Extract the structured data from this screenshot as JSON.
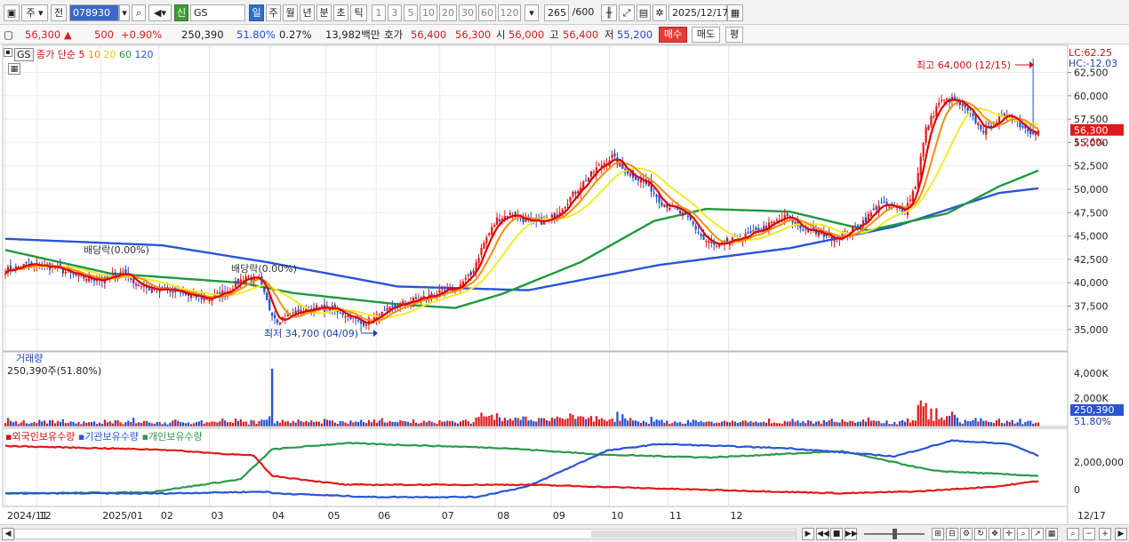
{
  "toolbar": {
    "market": "주",
    "prev": "전",
    "code": "078930",
    "badge_sin": "신",
    "name": "GS",
    "periods": [
      "일",
      "주",
      "월",
      "년",
      "분",
      "초",
      "틱"
    ],
    "active_period": "일",
    "intervals": [
      "1",
      "3",
      "5",
      "10",
      "20",
      "30",
      "60",
      "120"
    ],
    "count": "265",
    "count_total": "/600",
    "date": "2025/12/17"
  },
  "quote": {
    "price": "56,300",
    "arrow": "▲",
    "change": "500",
    "change_pct": "+0.90%",
    "volume": "250,390",
    "vol_ratio": "51.80%",
    "turnover_pct": "0.27%",
    "amount": "13,982백만",
    "ask_label": "호가",
    "ask1": "56,400",
    "bid1": "56,300",
    "open_label": "시",
    "open": "56,000",
    "high_label": "고",
    "high": "56,400",
    "low_label": "저",
    "low": "55,200",
    "buy": "매수",
    "sell": "매도",
    "avg": "평"
  },
  "colors": {
    "up": "#e01a1a",
    "down": "#1f4fd0",
    "ma5": "#e00000",
    "ma10": "#f0900a",
    "ma20": "#f3ea2a",
    "ma60": "#1f9a3c",
    "ma120": "#2a54d6",
    "foreign": "#e01a1a",
    "inst": "#2a54d6",
    "indiv": "#2a9a4a"
  },
  "price_panel": {
    "symbol_tag": "GS",
    "legend_title": "종가 단순",
    "ma_periods": [
      "5",
      "10",
      "20",
      "60",
      "120"
    ],
    "lc": "LC:62.25",
    "hc": "HC:-12.03",
    "max_label": "최고 64,000 (12/15)",
    "min_label": "최저 34,700 (04/09)",
    "div1": "배당락(0.00%)",
    "div2": "배당락(0.00%)",
    "last_price_tag": "56,300",
    "last_pct_tag": "1.26%"
  },
  "volume_panel": {
    "title": "거래량",
    "value": "250,390주(51.80%)",
    "axis_labels": [
      "4,000K",
      "2,000K"
    ],
    "last_tag": "250,390",
    "last_pct": "51.80%"
  },
  "holder_panel": {
    "legend": [
      "외국인보유수량",
      "기관보유수량",
      "개인보유수량"
    ],
    "axis_labels": [
      "2,000,000",
      "0"
    ]
  },
  "x_axis": {
    "labels": [
      "2024/11",
      "12",
      "2025/01",
      "02",
      "03",
      "04",
      "05",
      "06",
      "07",
      "08",
      "09",
      "10",
      "11",
      "12"
    ],
    "right_label": "12/17"
  },
  "chart_data": {
    "type": "candlestick",
    "y_ticks": [
      35000,
      37500,
      40000,
      42500,
      45000,
      47500,
      50000,
      52500,
      55000,
      57500,
      60000,
      62500
    ],
    "ylim": [
      32700,
      65300
    ],
    "max": {
      "value": 64000,
      "date": "12/15"
    },
    "min": {
      "value": 34700,
      "date": "04/09"
    },
    "close_anchors": [
      [
        0,
        41300
      ],
      [
        8,
        41900
      ],
      [
        18,
        41700
      ],
      [
        28,
        40600
      ],
      [
        38,
        40300
      ],
      [
        45,
        41200
      ],
      [
        52,
        39500
      ],
      [
        62,
        39300
      ],
      [
        70,
        38600
      ],
      [
        78,
        38300
      ],
      [
        85,
        39200
      ],
      [
        92,
        40700
      ],
      [
        97,
        40200
      ],
      [
        101,
        37200
      ],
      [
        104,
        36000
      ],
      [
        111,
        36800
      ],
      [
        118,
        37300
      ],
      [
        125,
        37200
      ],
      [
        132,
        36400
      ],
      [
        136,
        35600
      ],
      [
        142,
        36300
      ],
      [
        150,
        37600
      ],
      [
        157,
        38200
      ],
      [
        165,
        38800
      ],
      [
        172,
        39400
      ],
      [
        178,
        40800
      ],
      [
        183,
        44300
      ],
      [
        188,
        46800
      ],
      [
        194,
        47400
      ],
      [
        201,
        46300
      ],
      [
        208,
        46700
      ],
      [
        214,
        48400
      ],
      [
        220,
        50400
      ],
      [
        226,
        52200
      ],
      [
        232,
        53500
      ],
      [
        236,
        52200
      ],
      [
        241,
        51300
      ],
      [
        246,
        50400
      ],
      [
        251,
        48600
      ],
      [
        256,
        47900
      ],
      [
        262,
        46600
      ],
      [
        267,
        44600
      ],
      [
        272,
        43800
      ],
      [
        279,
        44600
      ],
      [
        286,
        45300
      ],
      [
        293,
        46300
      ],
      [
        299,
        47100
      ],
      [
        304,
        45900
      ],
      [
        309,
        45400
      ],
      [
        314,
        45100
      ],
      [
        318,
        44700
      ],
      [
        323,
        45600
      ],
      [
        329,
        46800
      ],
      [
        334,
        48400
      ],
      [
        339,
        48000
      ],
      [
        344,
        47800
      ],
      [
        348,
        50400
      ],
      [
        352,
        56400
      ],
      [
        357,
        59300
      ],
      [
        362,
        59600
      ],
      [
        366,
        58900
      ],
      [
        370,
        57600
      ],
      [
        374,
        56300
      ],
      [
        379,
        57300
      ],
      [
        384,
        58100
      ],
      [
        388,
        56900
      ],
      [
        392,
        56200
      ],
      [
        395,
        56300
      ]
    ],
    "ma60_anchors": [
      [
        0,
        43500
      ],
      [
        40,
        41000
      ],
      [
        90,
        40000
      ],
      [
        110,
        38900
      ],
      [
        150,
        37700
      ],
      [
        172,
        37300
      ],
      [
        190,
        38800
      ],
      [
        220,
        42200
      ],
      [
        248,
        46600
      ],
      [
        268,
        47900
      ],
      [
        300,
        47600
      ],
      [
        330,
        45600
      ],
      [
        360,
        47400
      ],
      [
        380,
        50300
      ],
      [
        395,
        52000
      ]
    ],
    "ma120_anchors": [
      [
        0,
        44700
      ],
      [
        60,
        44000
      ],
      [
        100,
        42200
      ],
      [
        150,
        39600
      ],
      [
        200,
        39200
      ],
      [
        250,
        41900
      ],
      [
        300,
        43700
      ],
      [
        340,
        46000
      ],
      [
        380,
        49600
      ],
      [
        395,
        50100
      ]
    ],
    "volume_spike": {
      "index": 102,
      "value": 4650000
    },
    "holders": {
      "foreign": [
        [
          0,
          2880000
        ],
        [
          60,
          2660000
        ],
        [
          95,
          2300000
        ],
        [
          102,
          1100000
        ],
        [
          130,
          570000
        ],
        [
          200,
          570000
        ],
        [
          260,
          300000
        ],
        [
          320,
          60000
        ],
        [
          350,
          180000
        ],
        [
          380,
          480000
        ],
        [
          395,
          800000
        ]
      ],
      "inst": [
        [
          0,
          60000
        ],
        [
          60,
          50000
        ],
        [
          100,
          160000
        ],
        [
          102,
          70000
        ],
        [
          140,
          -160000
        ],
        [
          180,
          -160000
        ],
        [
          200,
          480000
        ],
        [
          230,
          2600000
        ],
        [
          250,
          3000000
        ],
        [
          300,
          2740000
        ],
        [
          340,
          2260000
        ],
        [
          362,
          3200000
        ],
        [
          384,
          3000000
        ],
        [
          395,
          2300000
        ]
      ],
      "indiv": [
        [
          0,
          60000
        ],
        [
          55,
          120000
        ],
        [
          90,
          900000
        ],
        [
          102,
          2680000
        ],
        [
          130,
          3050000
        ],
        [
          190,
          2760000
        ],
        [
          230,
          2350000
        ],
        [
          270,
          2200000
        ],
        [
          320,
          2570000
        ],
        [
          355,
          1400000
        ],
        [
          395,
          1100000
        ]
      ]
    }
  }
}
